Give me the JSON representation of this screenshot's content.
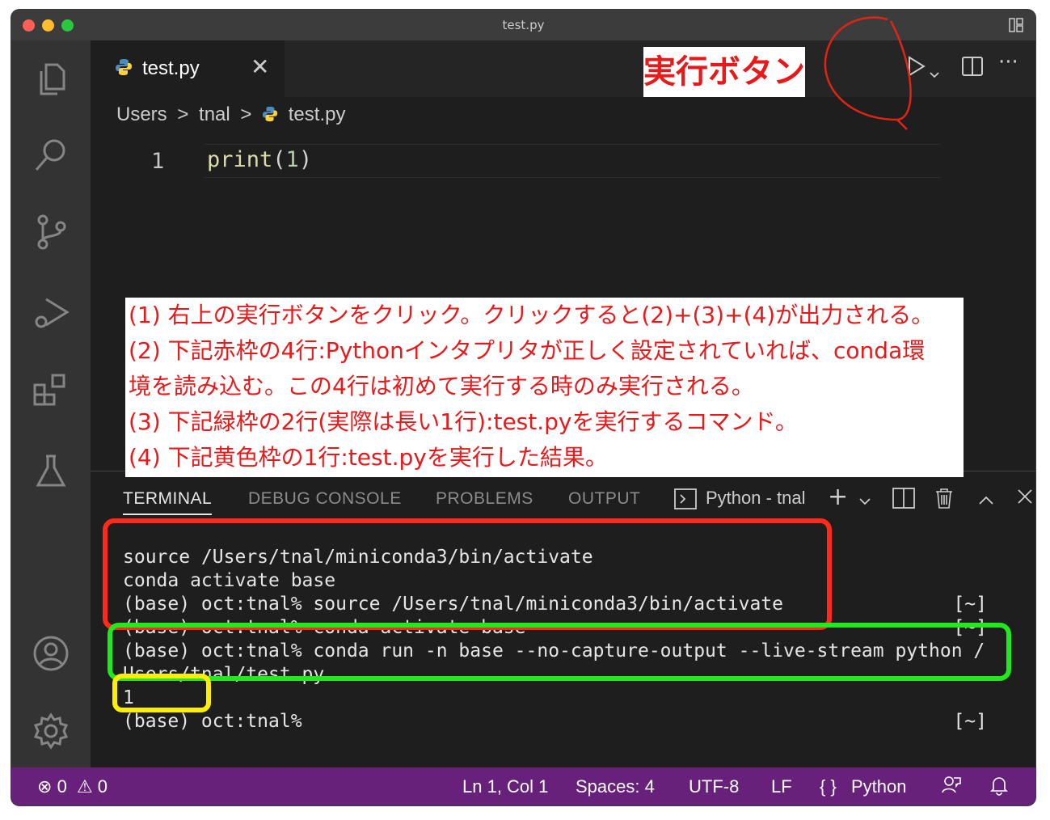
{
  "window": {
    "title": "test.py"
  },
  "tab": {
    "label": "test.py",
    "close": "✕"
  },
  "breadcrumb": {
    "part1": "Users",
    "part2": "tnal",
    "part3": "test.py",
    "sep": ">"
  },
  "editor": {
    "line_number": "1",
    "code_fn": "print",
    "code_open": "(",
    "code_num": "1",
    "code_close": ")"
  },
  "annotation": {
    "run_label": "実行ボタン",
    "lines": [
      "(1) 右上の実行ボタンをクリック。クリックすると(2)+(3)+(4)が出力される。",
      "(2) 下記赤枠の4行:Pythonインタプリタが正しく設定されていれば、conda環",
      "境を読み込む。この4行は初めて実行する時のみ実行される。",
      "(3) 下記緑枠の2行(実際は長い1行):test.pyを実行するコマンド。",
      "(4) 下記黄色枠の1行:test.pyを実行した結果。"
    ]
  },
  "panel": {
    "tabs": [
      "TERMINAL",
      "DEBUG CONSOLE",
      "PROBLEMS",
      "OUTPUT"
    ],
    "terminal_name": "Python - tnal"
  },
  "terminal": {
    "lines": [
      {
        "text": "source /Users/tnal/miniconda3/bin/activate",
        "right": ""
      },
      {
        "text": "conda activate base",
        "right": ""
      },
      {
        "text": "(base) oct:tnal% source /Users/tnal/miniconda3/bin/activate",
        "right": "[~]"
      },
      {
        "text": "(base) oct:tnal% conda activate base",
        "right": "[~]"
      },
      {
        "text": "(base) oct:tnal% conda run -n base --no-capture-output --live-stream python /",
        "right": ""
      },
      {
        "text": "Users/tnal/test.py",
        "right": ""
      },
      {
        "text": "1",
        "right": ""
      },
      {
        "text": "(base) oct:tnal%",
        "right": "[~]"
      }
    ]
  },
  "status": {
    "errors": "0",
    "warnings": "0",
    "position": "Ln 1, Col 1",
    "spaces": "Spaces: 4",
    "encoding": "UTF-8",
    "eol": "LF",
    "language": "Python"
  },
  "colors": {
    "accent_status": "#68217a",
    "annotation_red": "#e8191a",
    "box_red": "#ff2a1a",
    "box_green": "#22e81e",
    "box_yellow": "#ffee00"
  }
}
